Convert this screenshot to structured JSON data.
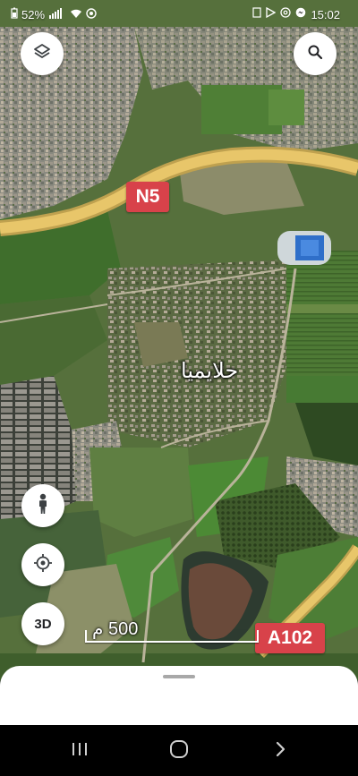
{
  "status_bar": {
    "battery": "52%",
    "time": "15:02"
  },
  "map": {
    "routes": [
      {
        "id": "n5",
        "label": "N5"
      },
      {
        "id": "a102",
        "label": "A102"
      }
    ],
    "place_label": "حلايميا",
    "scale_label": "500 م",
    "colors": {
      "route_shield": "#d8424a",
      "road": "#e8c66a"
    }
  },
  "controls": {
    "layers_icon": "layers-icon",
    "search_icon": "search-icon",
    "street_view_icon": "pegman-icon",
    "locate_icon": "my-location-icon",
    "three_d_label": "3D"
  }
}
